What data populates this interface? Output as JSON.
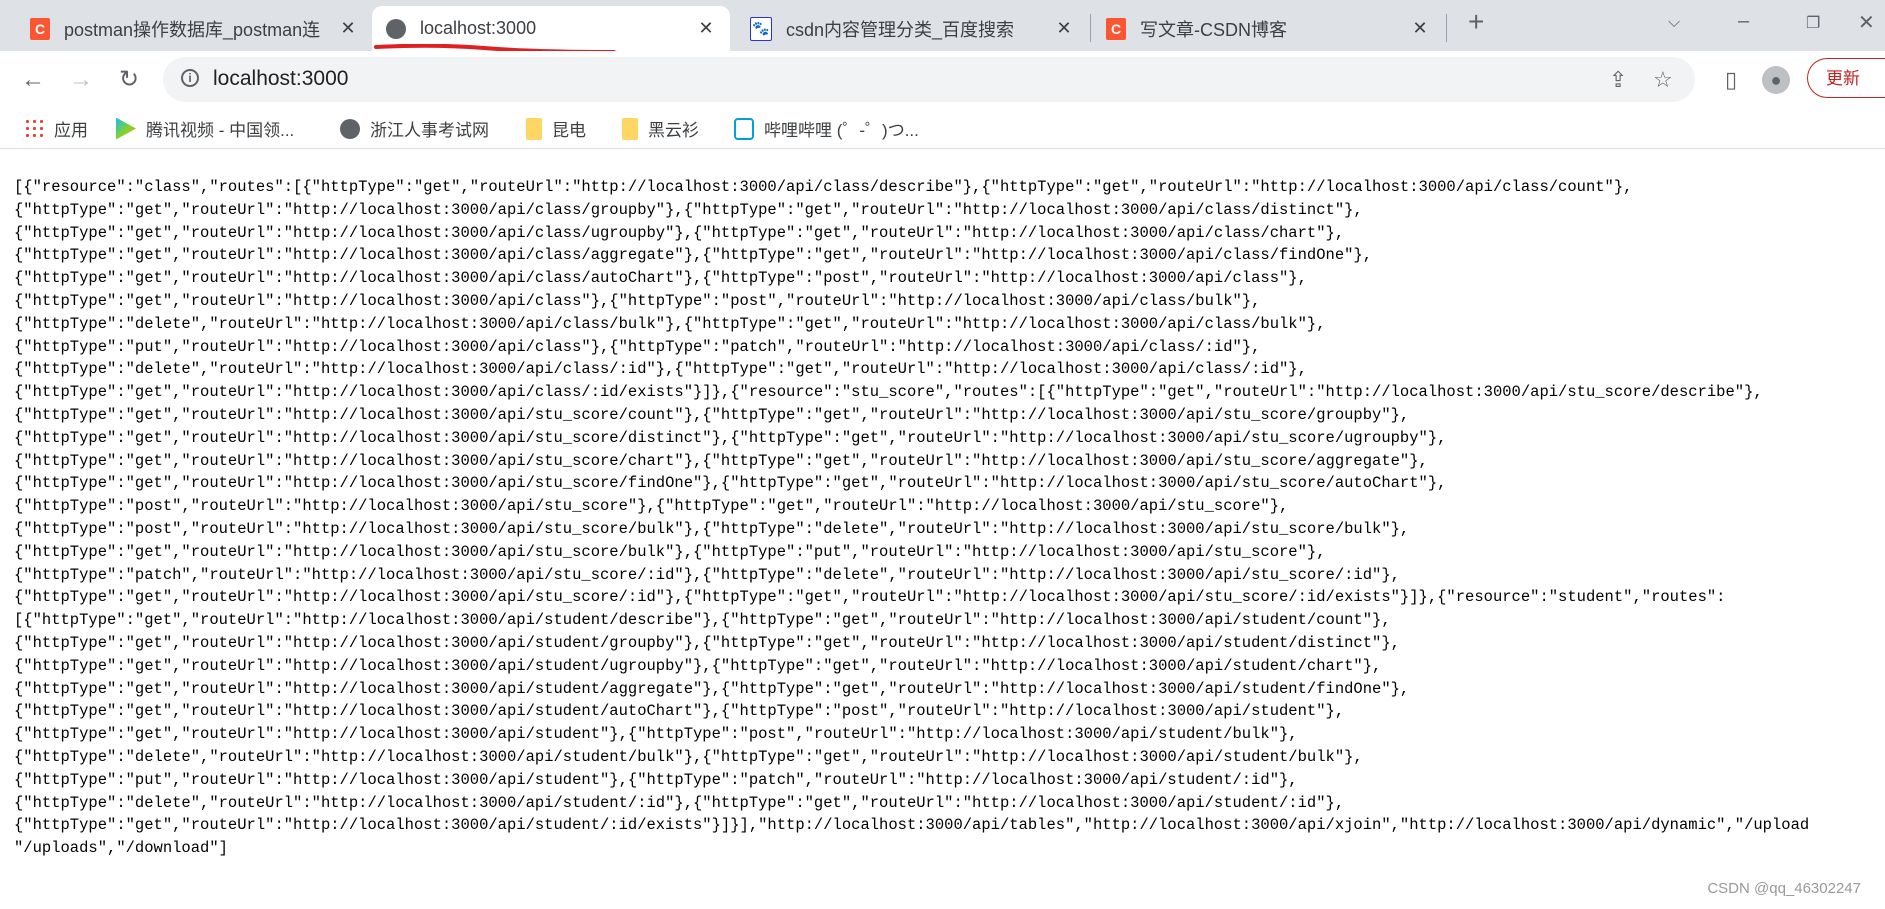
{
  "browser": {
    "tabs": [
      {
        "title": "postman操作数据库_postman连",
        "favicon": "csdn-icon",
        "active": false
      },
      {
        "title": "localhost:3000",
        "favicon": "globe-icon",
        "active": true
      },
      {
        "title": "csdn内容管理分类_百度搜索",
        "favicon": "baidu-icon",
        "active": false
      },
      {
        "title": "写文章-CSDN博客",
        "favicon": "csdn-icon",
        "active": false
      }
    ],
    "address": "localhost:3000",
    "update_label": "更新",
    "accent": "#c5221f",
    "annotation_color": "#e02020"
  },
  "bookmarks": [
    {
      "label": "应用",
      "icon": "apps-icon"
    },
    {
      "label": "腾讯视频 - 中国领...",
      "icon": "tencent-video-icon"
    },
    {
      "label": "浙江人事考试网",
      "icon": "globe-icon"
    },
    {
      "label": "昆电",
      "icon": "folder-icon"
    },
    {
      "label": "黑云衫",
      "icon": "folder-icon"
    },
    {
      "label": "哔哩哔哩 (゜-゜)つ...",
      "icon": "bilibili-icon"
    }
  ],
  "content_lines": [
    "[{\"resource\":\"class\",\"routes\":[{\"httpType\":\"get\",\"routeUrl\":\"http://localhost:3000/api/class/describe\"},{\"httpType\":\"get\",\"routeUrl\":\"http://localhost:3000/api/class/count\"},",
    "{\"httpType\":\"get\",\"routeUrl\":\"http://localhost:3000/api/class/groupby\"},{\"httpType\":\"get\",\"routeUrl\":\"http://localhost:3000/api/class/distinct\"},",
    "{\"httpType\":\"get\",\"routeUrl\":\"http://localhost:3000/api/class/ugroupby\"},{\"httpType\":\"get\",\"routeUrl\":\"http://localhost:3000/api/class/chart\"},",
    "{\"httpType\":\"get\",\"routeUrl\":\"http://localhost:3000/api/class/aggregate\"},{\"httpType\":\"get\",\"routeUrl\":\"http://localhost:3000/api/class/findOne\"},",
    "{\"httpType\":\"get\",\"routeUrl\":\"http://localhost:3000/api/class/autoChart\"},{\"httpType\":\"post\",\"routeUrl\":\"http://localhost:3000/api/class\"},",
    "{\"httpType\":\"get\",\"routeUrl\":\"http://localhost:3000/api/class\"},{\"httpType\":\"post\",\"routeUrl\":\"http://localhost:3000/api/class/bulk\"},",
    "{\"httpType\":\"delete\",\"routeUrl\":\"http://localhost:3000/api/class/bulk\"},{\"httpType\":\"get\",\"routeUrl\":\"http://localhost:3000/api/class/bulk\"},",
    "{\"httpType\":\"put\",\"routeUrl\":\"http://localhost:3000/api/class\"},{\"httpType\":\"patch\",\"routeUrl\":\"http://localhost:3000/api/class/:id\"},",
    "{\"httpType\":\"delete\",\"routeUrl\":\"http://localhost:3000/api/class/:id\"},{\"httpType\":\"get\",\"routeUrl\":\"http://localhost:3000/api/class/:id\"},",
    "{\"httpType\":\"get\",\"routeUrl\":\"http://localhost:3000/api/class/:id/exists\"}]},{\"resource\":\"stu_score\",\"routes\":[{\"httpType\":\"get\",\"routeUrl\":\"http://localhost:3000/api/stu_score/describe\"},",
    "{\"httpType\":\"get\",\"routeUrl\":\"http://localhost:3000/api/stu_score/count\"},{\"httpType\":\"get\",\"routeUrl\":\"http://localhost:3000/api/stu_score/groupby\"},",
    "{\"httpType\":\"get\",\"routeUrl\":\"http://localhost:3000/api/stu_score/distinct\"},{\"httpType\":\"get\",\"routeUrl\":\"http://localhost:3000/api/stu_score/ugroupby\"},",
    "{\"httpType\":\"get\",\"routeUrl\":\"http://localhost:3000/api/stu_score/chart\"},{\"httpType\":\"get\",\"routeUrl\":\"http://localhost:3000/api/stu_score/aggregate\"},",
    "{\"httpType\":\"get\",\"routeUrl\":\"http://localhost:3000/api/stu_score/findOne\"},{\"httpType\":\"get\",\"routeUrl\":\"http://localhost:3000/api/stu_score/autoChart\"},",
    "{\"httpType\":\"post\",\"routeUrl\":\"http://localhost:3000/api/stu_score\"},{\"httpType\":\"get\",\"routeUrl\":\"http://localhost:3000/api/stu_score\"},",
    "{\"httpType\":\"post\",\"routeUrl\":\"http://localhost:3000/api/stu_score/bulk\"},{\"httpType\":\"delete\",\"routeUrl\":\"http://localhost:3000/api/stu_score/bulk\"},",
    "{\"httpType\":\"get\",\"routeUrl\":\"http://localhost:3000/api/stu_score/bulk\"},{\"httpType\":\"put\",\"routeUrl\":\"http://localhost:3000/api/stu_score\"},",
    "{\"httpType\":\"patch\",\"routeUrl\":\"http://localhost:3000/api/stu_score/:id\"},{\"httpType\":\"delete\",\"routeUrl\":\"http://localhost:3000/api/stu_score/:id\"},",
    "{\"httpType\":\"get\",\"routeUrl\":\"http://localhost:3000/api/stu_score/:id\"},{\"httpType\":\"get\",\"routeUrl\":\"http://localhost:3000/api/stu_score/:id/exists\"}]},{\"resource\":\"student\",\"routes\":",
    "[{\"httpType\":\"get\",\"routeUrl\":\"http://localhost:3000/api/student/describe\"},{\"httpType\":\"get\",\"routeUrl\":\"http://localhost:3000/api/student/count\"},",
    "{\"httpType\":\"get\",\"routeUrl\":\"http://localhost:3000/api/student/groupby\"},{\"httpType\":\"get\",\"routeUrl\":\"http://localhost:3000/api/student/distinct\"},",
    "{\"httpType\":\"get\",\"routeUrl\":\"http://localhost:3000/api/student/ugroupby\"},{\"httpType\":\"get\",\"routeUrl\":\"http://localhost:3000/api/student/chart\"},",
    "{\"httpType\":\"get\",\"routeUrl\":\"http://localhost:3000/api/student/aggregate\"},{\"httpType\":\"get\",\"routeUrl\":\"http://localhost:3000/api/student/findOne\"},",
    "{\"httpType\":\"get\",\"routeUrl\":\"http://localhost:3000/api/student/autoChart\"},{\"httpType\":\"post\",\"routeUrl\":\"http://localhost:3000/api/student\"},",
    "{\"httpType\":\"get\",\"routeUrl\":\"http://localhost:3000/api/student\"},{\"httpType\":\"post\",\"routeUrl\":\"http://localhost:3000/api/student/bulk\"},",
    "{\"httpType\":\"delete\",\"routeUrl\":\"http://localhost:3000/api/student/bulk\"},{\"httpType\":\"get\",\"routeUrl\":\"http://localhost:3000/api/student/bulk\"},",
    "{\"httpType\":\"put\",\"routeUrl\":\"http://localhost:3000/api/student\"},{\"httpType\":\"patch\",\"routeUrl\":\"http://localhost:3000/api/student/:id\"},",
    "{\"httpType\":\"delete\",\"routeUrl\":\"http://localhost:3000/api/student/:id\"},{\"httpType\":\"get\",\"routeUrl\":\"http://localhost:3000/api/student/:id\"},",
    "{\"httpType\":\"get\",\"routeUrl\":\"http://localhost:3000/api/student/:id/exists\"}]}],\"http://localhost:3000/api/tables\",\"http://localhost:3000/api/xjoin\",\"http://localhost:3000/api/dynamic\",\"/upload",
    "\"/uploads\",\"/download\"]"
  ],
  "watermark": "CSDN @qq_46302247"
}
